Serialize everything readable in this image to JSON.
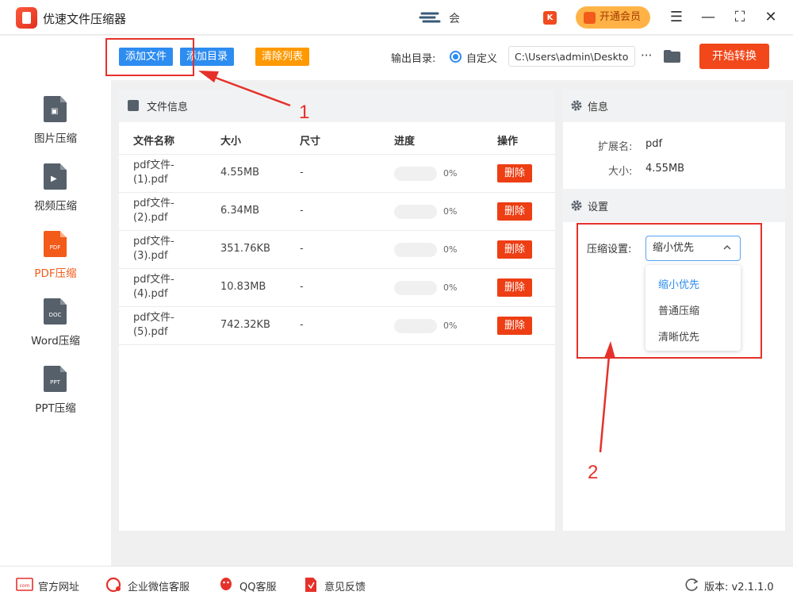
{
  "app": {
    "title": "优速文件压缩器"
  },
  "titlebar": {
    "partner_text": "会",
    "k_badge": "K",
    "vip_label": "开通会员",
    "menu_glyph": "☰",
    "minimize_glyph": "—",
    "maximize_glyph": "⛶",
    "close_glyph": "✕"
  },
  "sidebar": {
    "items": [
      {
        "label": "图片压缩",
        "icon": "image-file-icon",
        "badge": ""
      },
      {
        "label": "视频压缩",
        "icon": "video-file-icon",
        "badge": ""
      },
      {
        "label": "PDF压缩",
        "icon": "pdf-file-icon",
        "badge": "PDF",
        "active": true
      },
      {
        "label": "Word压缩",
        "icon": "doc-file-icon",
        "badge": "DOC"
      },
      {
        "label": "PPT压缩",
        "icon": "ppt-file-icon",
        "badge": "PPT"
      }
    ]
  },
  "toolbar": {
    "add_file": "添加文件",
    "add_folder": "添加目录",
    "clear_list": "清除列表",
    "output_label": "输出目录:",
    "custom_label": "自定义",
    "output_path": "C:\\Users\\admin\\Desktop",
    "more_glyph": "···",
    "start": "开始转换"
  },
  "file_panel": {
    "title": "文件信息",
    "columns": {
      "name": "文件名称",
      "size": "大小",
      "dimensions": "尺寸",
      "progress": "进度",
      "action": "操作"
    },
    "rows": [
      {
        "name": "pdf文件-(1).pdf",
        "size": "4.55MB",
        "dimensions": "-",
        "progress": 0,
        "progress_text": "0%",
        "action": "删除"
      },
      {
        "name": "pdf文件-(2).pdf",
        "size": "6.34MB",
        "dimensions": "-",
        "progress": 0,
        "progress_text": "0%",
        "action": "删除"
      },
      {
        "name": "pdf文件-(3).pdf",
        "size": "351.76KB",
        "dimensions": "-",
        "progress": 0,
        "progress_text": "0%",
        "action": "删除"
      },
      {
        "name": "pdf文件-(4).pdf",
        "size": "10.83MB",
        "dimensions": "-",
        "progress": 0,
        "progress_text": "0%",
        "action": "删除"
      },
      {
        "name": "pdf文件-(5).pdf",
        "size": "742.32KB",
        "dimensions": "-",
        "progress": 0,
        "progress_text": "0%",
        "action": "删除"
      }
    ]
  },
  "info_panel": {
    "title": "信息",
    "ext_label": "扩展名:",
    "ext_value": "pdf",
    "size_label": "大小:",
    "size_value": "4.55MB"
  },
  "settings_panel": {
    "title": "设置",
    "compress_label": "压缩设置:",
    "selected": "缩小优先",
    "options": [
      "缩小优先",
      "普通压缩",
      "清晰优先"
    ]
  },
  "annotations": {
    "step1": "1",
    "step2": "2"
  },
  "footer": {
    "website": "官方网址",
    "wechat": "企业微信客服",
    "qq": "QQ客服",
    "feedback": "意见反馈",
    "version": "版本:  v2.1.1.0"
  },
  "colors": {
    "primary": "#2d8cf0",
    "accent": "#f2471a",
    "warning": "#ff9900",
    "annotation": "#e5312a"
  }
}
